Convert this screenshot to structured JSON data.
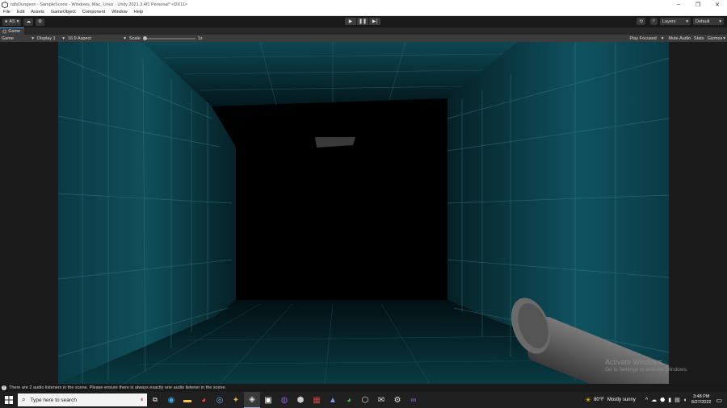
{
  "window": {
    "title": "rafsDungeon - SampleScene - Windows, Mac, Linux - Unity 2021.3.4f1 Personal* <DX11>",
    "minimize": "–",
    "maximize": "❐",
    "close": "✕"
  },
  "menu": [
    "File",
    "Edit",
    "Assets",
    "GameObject",
    "Component",
    "Window",
    "Help"
  ],
  "toolbar": {
    "account": "AS",
    "layers": "Layers",
    "layout": "Default"
  },
  "tab": {
    "label": "Game"
  },
  "gamebar": {
    "mode": "Game",
    "display": "Display 1",
    "aspect": "16:9 Aspect",
    "scale_label": "Scale",
    "scale_value": "1x",
    "play_focused": "Play Focused",
    "mute_audio": "Mute Audio",
    "stats": "Stats",
    "gizmos": "Gizmos"
  },
  "watermark": {
    "line1": "Activate Windows",
    "line2": "Go to Settings to activate Windows."
  },
  "status": {
    "message": "There are 2 audio listeners in the scene. Please ensure there is always exactly one audio listener in the scene."
  },
  "taskbar": {
    "search_placeholder": "Type here to search",
    "weather_temp": "80°F",
    "weather_text": "Mostly sunny",
    "time": "3:48 PM",
    "date": "6/27/2022"
  },
  "colors": {
    "wall_teal": "#0d4a55",
    "editor_bg": "#1e1e1e",
    "toolbar_bg": "#191919",
    "accent": "#4d8fd1"
  }
}
